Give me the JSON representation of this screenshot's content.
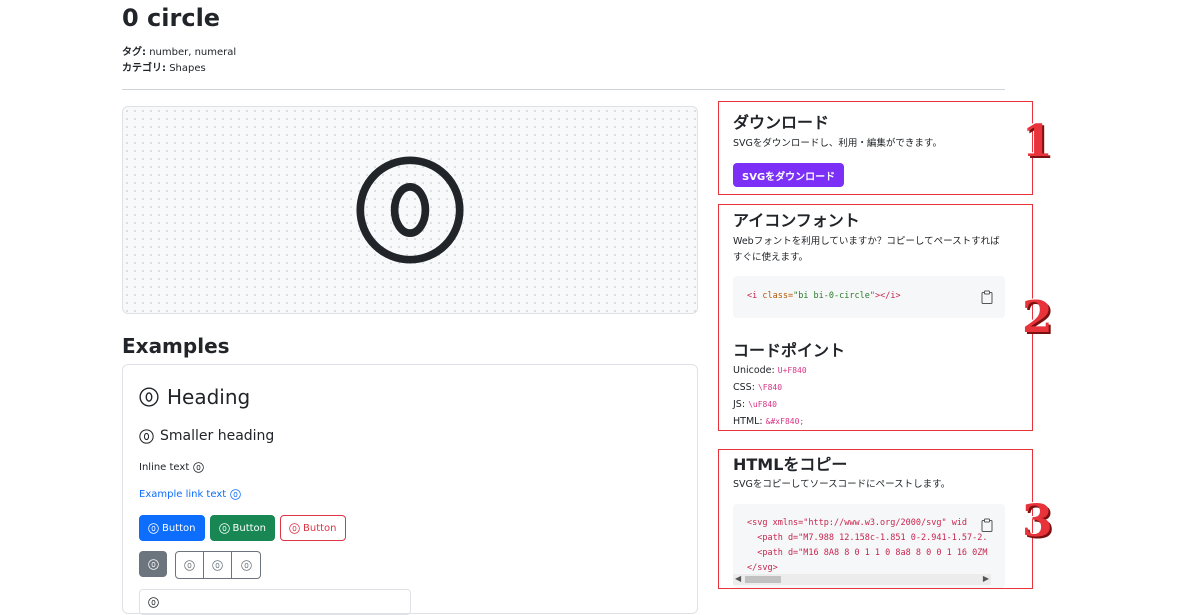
{
  "page": {
    "title": "0 circle",
    "tags_label": "タグ:",
    "tags_value": "number, numeral",
    "category_label": "カテゴリ:",
    "category_value": "Shapes"
  },
  "examples": {
    "title": "Examples",
    "heading": "Heading",
    "smaller_heading": "Smaller heading",
    "inline_text": "Inline text",
    "link_text": "Example link text",
    "button_label": "Button"
  },
  "download": {
    "title": "ダウンロード",
    "description": "SVGをダウンロードし、利用・編集ができます。",
    "button_label": "SVGをダウンロード"
  },
  "icon_font": {
    "title": "アイコンフォント",
    "description": "Webフォントを利用していますか？コピーしてペーストすればすぐに使えます。",
    "code_open": "<i",
    "code_attr": " class=",
    "code_value": "\"bi bi-0-circle\"",
    "code_close": "></i>"
  },
  "code_points": {
    "title": "コードポイント",
    "unicode_label": "Unicode:",
    "unicode_value": "U+F840",
    "css_label": "CSS:",
    "css_value": "\\F840",
    "js_label": "JS:",
    "js_value": "\\uF840",
    "html_label": "HTML:",
    "html_value": "&#xF840;"
  },
  "copy_html": {
    "title": "HTMLをコピー",
    "description": "SVGをコピーしてソースコードにペーストします。",
    "line1": "<svg xmlns=\"http://www.w3.org/2000/svg\" wid",
    "line2": "  <path d=\"M7.988 12.158c-1.851 0-2.941-1.57-2.",
    "line3": "  <path d=\"M16 8A8 8 0 1 1 0 8a8 8 0 0 1 16 0ZM",
    "line4": "</svg>"
  },
  "annotations": [
    "1",
    "2",
    "3"
  ],
  "icons": {
    "preview": "zero-circle-icon",
    "copy": "clipboard-icon"
  },
  "colors": {
    "primary": "#0d6efd",
    "success": "#198754",
    "danger": "#dc3545",
    "download_button": "#7b2ff7",
    "annotation": "#e8333a",
    "code_pink": "#d63384"
  }
}
